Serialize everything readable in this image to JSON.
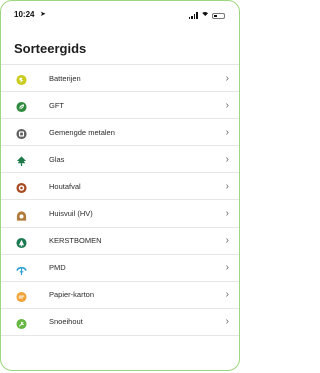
{
  "status": {
    "time": "10:24",
    "location_glyph": "➤"
  },
  "header": {
    "title": "Sorteergids"
  },
  "list": {
    "items": [
      {
        "label": "Batterijen",
        "icon": "battery-icon",
        "color": "#c9cc1f"
      },
      {
        "label": "GFT",
        "icon": "leaf-icon",
        "color": "#2e8b3d"
      },
      {
        "label": "Gemengde metalen",
        "icon": "metal-icon",
        "color": "#5e5e5e"
      },
      {
        "label": "Glas",
        "icon": "tree-icon",
        "color": "#1f7a4a"
      },
      {
        "label": "Houtafval",
        "icon": "wood-icon",
        "color": "#a74b22"
      },
      {
        "label": "Huisvuil (HV)",
        "icon": "bin-icon",
        "color": "#b07a3a"
      },
      {
        "label": "KERSTBOMEN",
        "icon": "christmas-tree-icon",
        "color": "#1e7a52"
      },
      {
        "label": "PMD",
        "icon": "pmd-icon",
        "color": "#2d9fd8"
      },
      {
        "label": "Papier-karton",
        "icon": "paper-icon",
        "color": "#f0a43a"
      },
      {
        "label": "Snoeihout",
        "icon": "branch-icon",
        "color": "#66b843"
      }
    ],
    "chevron": "›"
  }
}
